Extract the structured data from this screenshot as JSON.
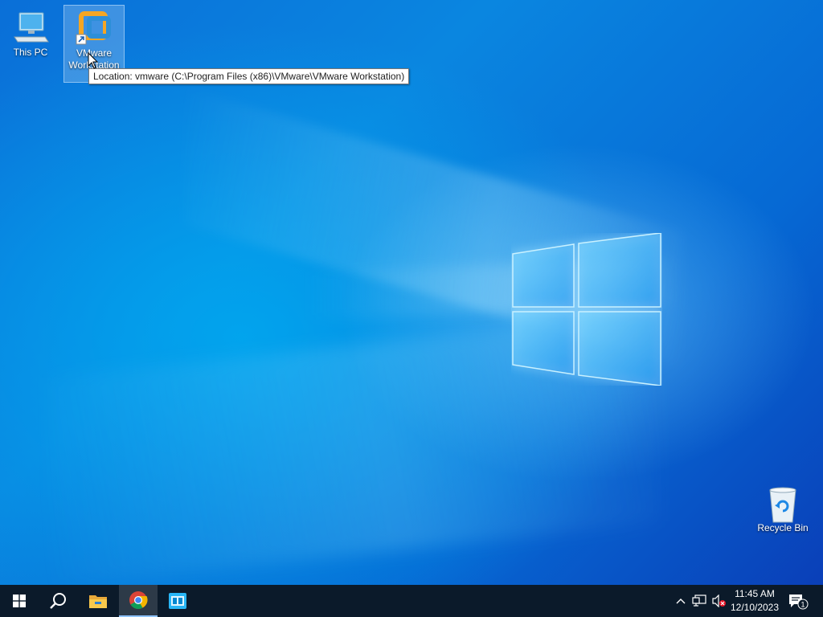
{
  "desktop": {
    "icons": [
      {
        "label": "This PC"
      },
      {
        "label": "VMware Workstation"
      },
      {
        "label": "Recycle Bin"
      }
    ],
    "tooltip": "Location: vmware (C:\\Program Files (x86)\\VMware\\VMware Workstation)"
  },
  "taskbar": {
    "buttons": [
      "windows-start-icon",
      "search-icon",
      "file-explorer-icon",
      "chrome-icon",
      "app-icon"
    ],
    "clock": {
      "time": "11:45 AM",
      "date": "12/10/2023"
    },
    "notification_count": "1"
  },
  "colors": {
    "desktop_blue": "#0a86e0",
    "taskbar": "#0b1a2a",
    "vmware_orange": "#f5a623"
  }
}
